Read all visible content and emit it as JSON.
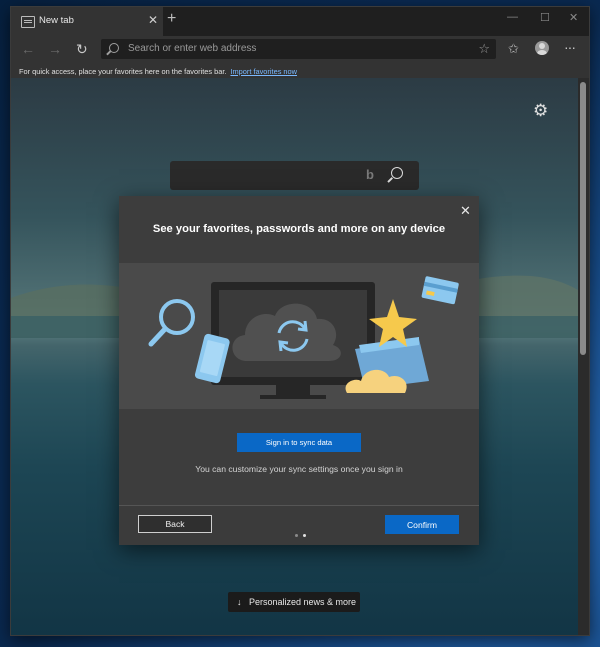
{
  "tab": {
    "title": "New tab",
    "close_glyph": "✕",
    "new_tab_glyph": "+"
  },
  "window_controls": {
    "minimize": "—",
    "maximize": "☐",
    "close": "✕"
  },
  "toolbar": {
    "back_glyph": "←",
    "forward_glyph": "→",
    "refresh_glyph": "↻",
    "address_placeholder": "Search or enter web address",
    "fav_star_glyph": "☆",
    "favorites_glyph": "✩",
    "more_glyph": "···"
  },
  "favorites_bar": {
    "message": "For quick access, place your favorites here on the favorites bar.",
    "link": "Import favorites now"
  },
  "content": {
    "gear_glyph": "⚙",
    "bing_glyph": "b",
    "news_button": "Personalized news & more",
    "news_arrow": "↓"
  },
  "dialog": {
    "close_glyph": "✕",
    "title": "See your favorites, passwords and more on any device",
    "sign_in_button": "Sign in to sync data",
    "note": "You can customize your sync settings once you sign in",
    "back_button": "Back",
    "confirm_button": "Confirm",
    "page_dots": {
      "total": 2,
      "active_index": 1
    }
  },
  "colors": {
    "accent": "#0a68c6",
    "link": "#79b8ff",
    "dialog_bg": "#3d3d3d",
    "hero_bg": "#4a4a4a",
    "hero_light_blue": "#8cc8ef",
    "hero_gold": "#f6c94c"
  },
  "icons": {
    "tab_icon": "newtab-icon",
    "hero": [
      "magnifier-icon",
      "phone-icon",
      "monitor-icon",
      "sync-cloud-icon",
      "star-icon",
      "folder-icon",
      "credit-card-icon",
      "cloud-icon"
    ]
  }
}
